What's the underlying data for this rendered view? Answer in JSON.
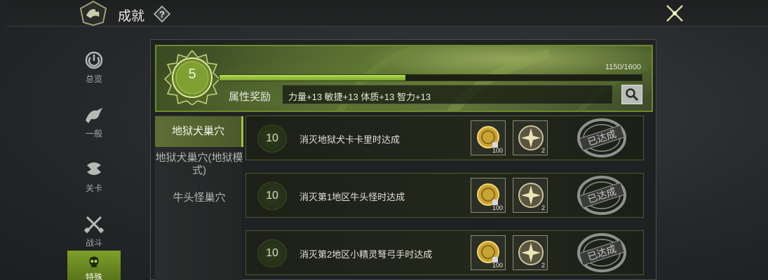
{
  "header": {
    "title": "成就",
    "help_icon": "question-icon",
    "close_icon": "close-x-icon"
  },
  "nav": {
    "items": [
      {
        "label": "总览",
        "icon": "overview-icon"
      },
      {
        "label": "一般",
        "icon": "dragon-icon"
      },
      {
        "label": "关卡",
        "icon": "stage-icon"
      },
      {
        "label": "战斗",
        "icon": "crossed-swords-icon"
      },
      {
        "label": "特殊",
        "icon": "skull-icon",
        "active": true
      }
    ]
  },
  "level": {
    "value": "5",
    "xp_text": "1150/1600",
    "progress": 0.44
  },
  "reward": {
    "label": "属性奖励",
    "value": "力量+13 敏捷+13 体质+13 智力+13"
  },
  "tabs": [
    {
      "label": "地狱犬巢穴",
      "active": true
    },
    {
      "label": "地狱犬巢穴(地狱模式)"
    },
    {
      "label": "牛头怪巢穴"
    }
  ],
  "achievements": [
    {
      "points": "10",
      "text": "消灭地狱犬卡卡里时达成",
      "reward1_count": "100",
      "reward2_count": "2",
      "status": "已达成"
    },
    {
      "points": "10",
      "text": "消灭第1地区牛头怪时达成",
      "reward1_count": "100",
      "reward2_count": "2",
      "status": "已达成"
    },
    {
      "points": "10",
      "text": "消灭第2地区小精灵弩弓手时达成",
      "reward1_count": "100",
      "reward2_count": "2",
      "status": "已达成"
    }
  ],
  "colors": {
    "accent": "#8db33a",
    "panel": "#1f2122",
    "text": "#e2e2da"
  }
}
